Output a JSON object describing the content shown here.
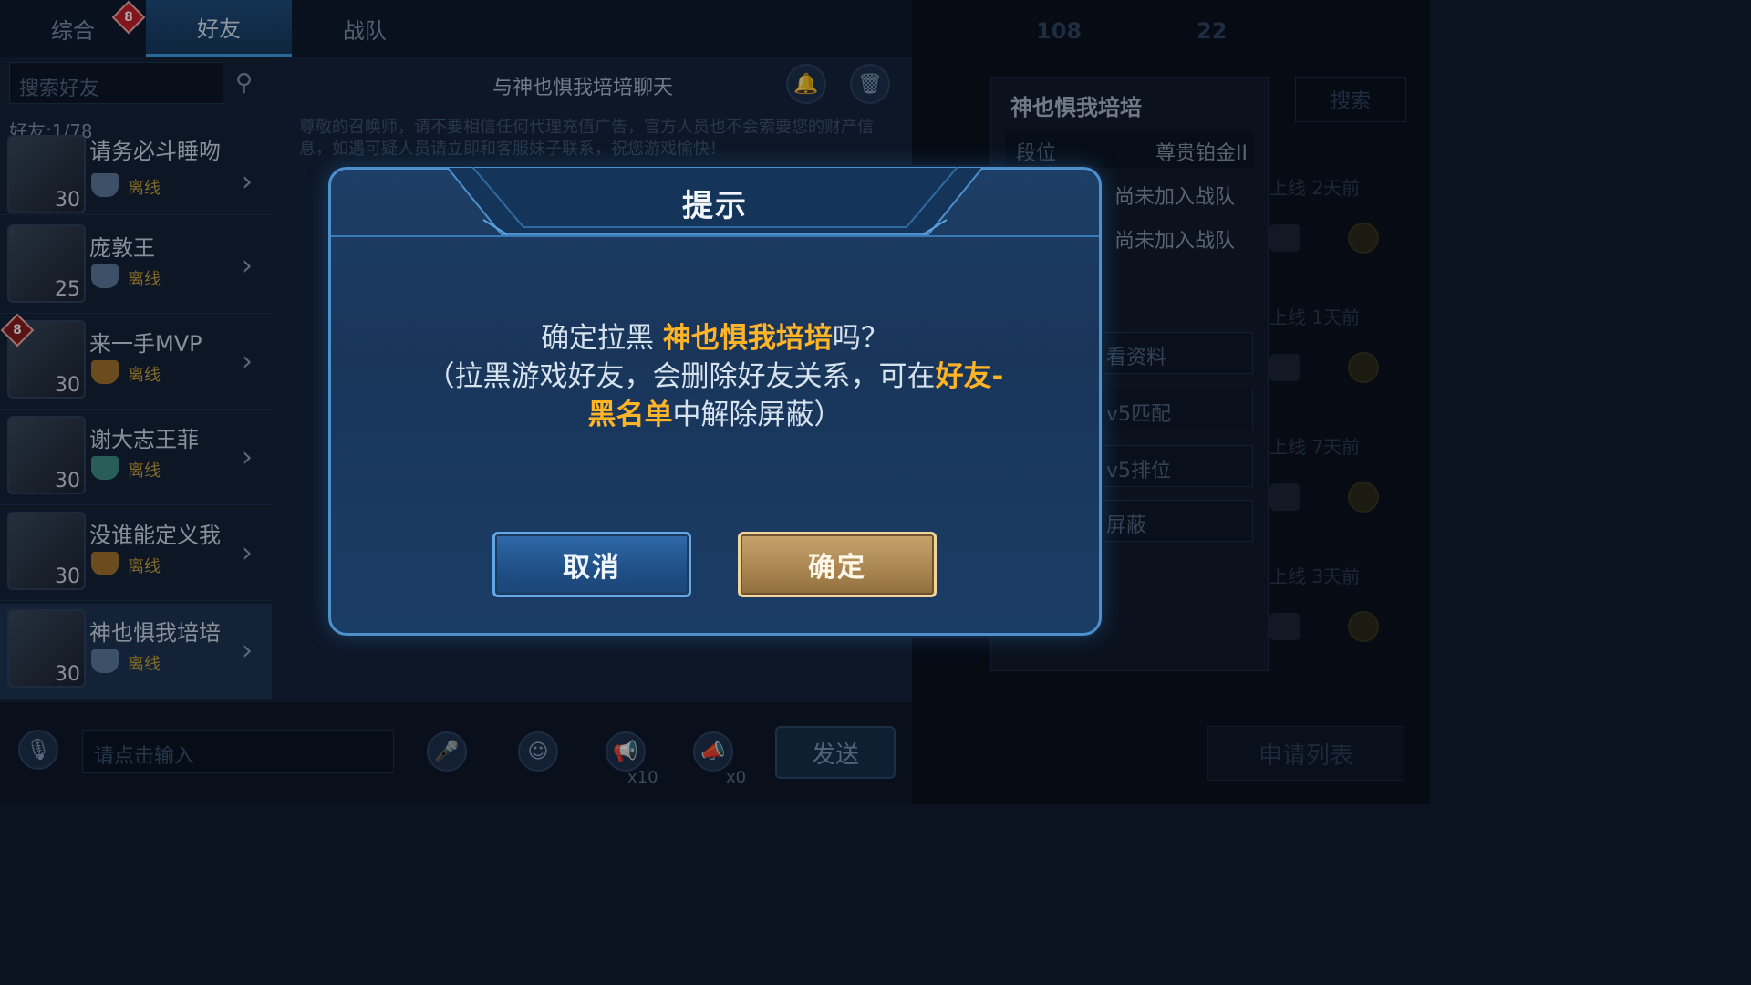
{
  "tabs": [
    {
      "label": "综合",
      "badge": "8"
    },
    {
      "label": "好友",
      "badge": ""
    },
    {
      "label": "战队",
      "badge": ""
    }
  ],
  "friends_panel": {
    "search_placeholder": "搜索好友",
    "count_text": "好友:1/78",
    "friends": [
      {
        "name": "请务必斗睡吻",
        "level": "30",
        "status": "离线"
      },
      {
        "name": "庞敦王",
        "level": "25",
        "status": "离线"
      },
      {
        "name": "来一手MVP",
        "level": "30",
        "status": "离线",
        "badge": "8"
      },
      {
        "name": "谢大志王菲",
        "level": "30",
        "status": "离线"
      },
      {
        "name": "没谁能定义我",
        "level": "30",
        "status": "离线"
      },
      {
        "name": "神也惧我培培",
        "level": "30",
        "status": "离线",
        "selected": true
      }
    ]
  },
  "chat": {
    "title": "与神也惧我培培聊天",
    "notice": "尊敬的召唤师，请不要相信任何代理充值广告，官方人员也不会索要您的财产信息，如遇可疑人员请立即和客服妹子联系，祝您游戏愉快！",
    "input_placeholder": "请点击输入",
    "send_label": "发送",
    "speaker_count_1": "x10",
    "speaker_count_2": "x0"
  },
  "top_stats": {
    "value_1": "108",
    "value_2": "22"
  },
  "profile": {
    "name": "神也惧我培培",
    "rank_label": "段位",
    "rank_value": "尊贵铂金II",
    "team_1": "尚未加入战队",
    "team_2": "尚未加入战队",
    "btn_view": "看资料",
    "btn_5v5_match": "v5匹配",
    "btn_5v5_rank": "v5排位",
    "btn_block": "屏蔽",
    "search_label": "搜索",
    "apply_list": "申请列表",
    "times": [
      "上线 2天前",
      "上线 1天前",
      "上线 7天前",
      "上线 3天前"
    ]
  },
  "dialog": {
    "title": "提示",
    "line1_prefix": "确定拉黑 ",
    "line1_name": "神也惧我培培",
    "line1_suffix": "吗？",
    "line2_prefix": "（拉黑游戏好友，会删除好友关系，可在",
    "line2_highlight": "好友-",
    "line3_highlight": "黑名单",
    "line3_suffix": "中解除屏蔽）",
    "cancel_label": "取消",
    "confirm_label": "确定"
  }
}
